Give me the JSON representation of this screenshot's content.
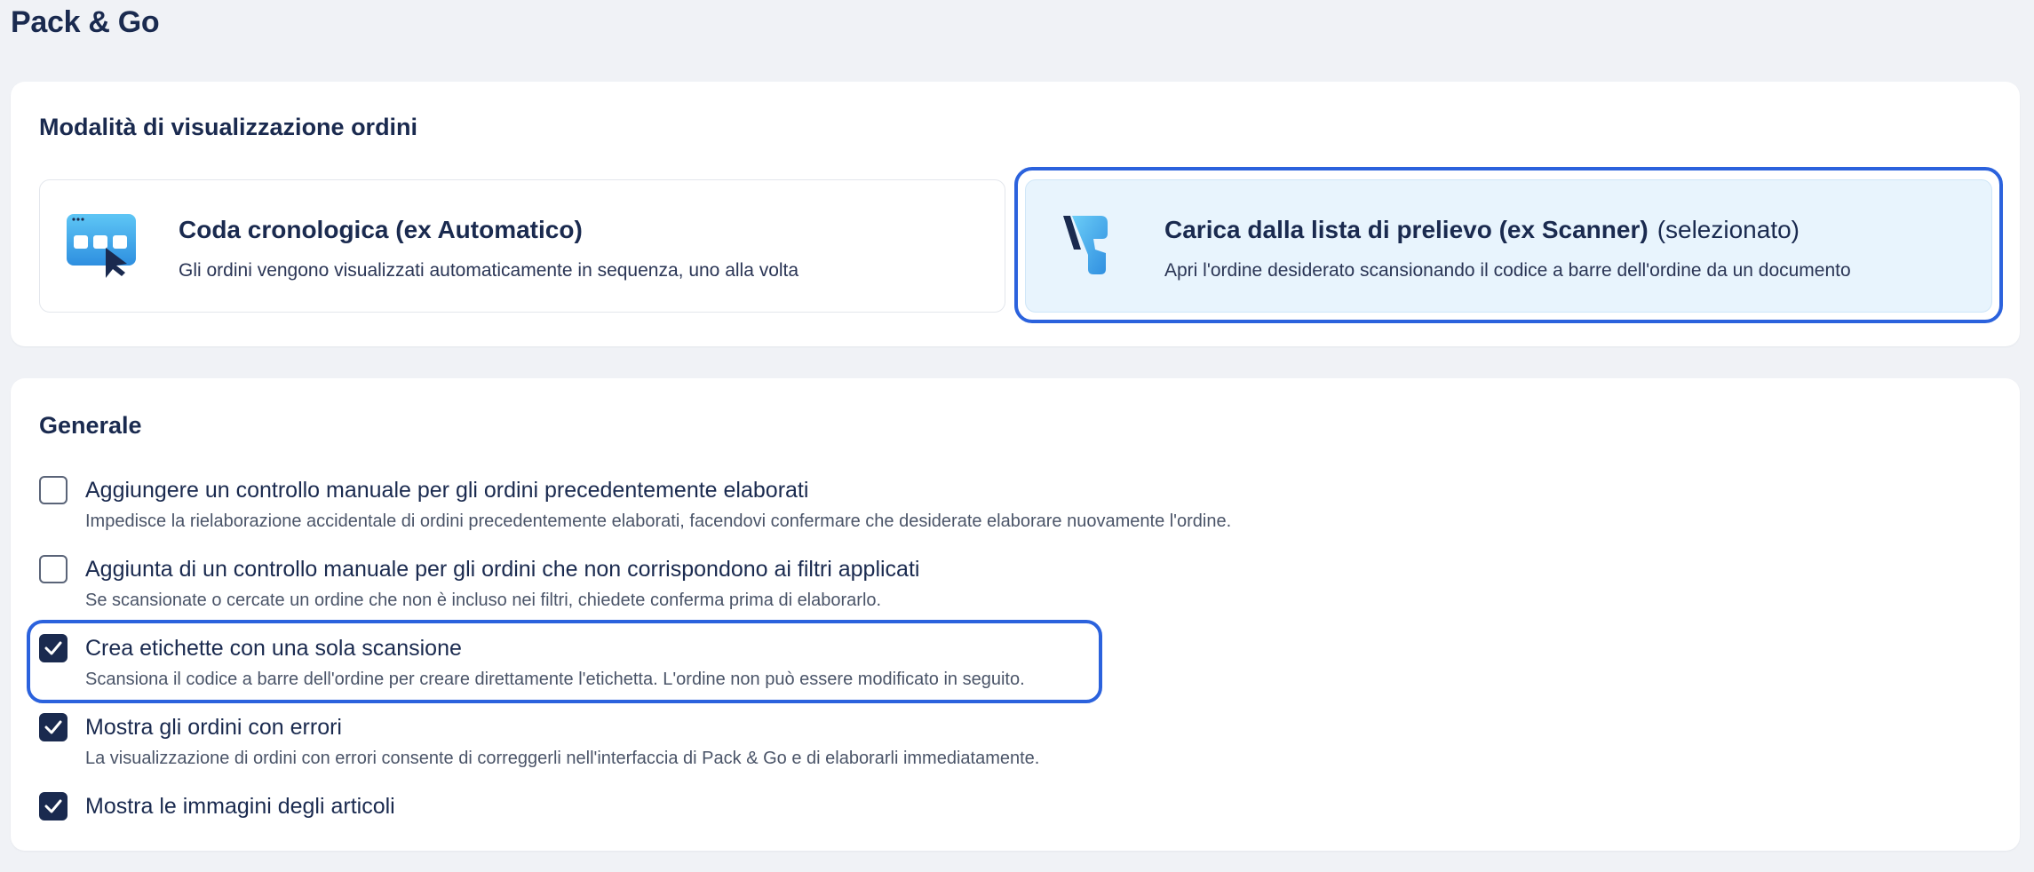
{
  "page": {
    "title": "Pack & Go"
  },
  "display_mode": {
    "heading": "Modalità di visualizzazione ordini",
    "options": [
      {
        "title": "Coda cronologica (ex Automatico)",
        "tag": "",
        "description": "Gli ordini vengono visualizzati automaticamente in sequenza, uno alla volta",
        "icon": "queue-cursor-icon",
        "selected": false
      },
      {
        "title": "Carica dalla lista di prelievo (ex Scanner)",
        "tag": "(selezionato)",
        "description": "Apri l'ordine desiderato scansionando il codice a barre dell'ordine da un documento",
        "icon": "barcode-scanner-icon",
        "selected": true
      }
    ]
  },
  "general": {
    "heading": "Generale",
    "options": [
      {
        "label": "Aggiungere un controllo manuale per gli ordini precedentemente elaborati",
        "description": "Impedisce la rielaborazione accidentale di ordini precedentemente elaborati, facendovi confermare che desiderate elaborare nuovamente l'ordine.",
        "checked": false
      },
      {
        "label": "Aggiunta di un controllo manuale per gli ordini che non corrispondono ai filtri applicati",
        "description": "Se scansionate o cercate un ordine che non è incluso nei filtri, chiedete conferma prima di elaborarlo.",
        "checked": false
      },
      {
        "label": "Crea etichette con una sola scansione",
        "description": "Scansiona il codice a barre dell'ordine per creare direttamente l'etichetta. L'ordine non può essere modificato in seguito.",
        "checked": true
      },
      {
        "label": "Mostra gli ordini con errori",
        "description": "La visualizzazione di ordini con errori consente di correggerli nell'interfaccia di Pack & Go e di elaborarli immediatamente.",
        "checked": true
      },
      {
        "label": "Mostra le immagini degli articoli",
        "description": "",
        "checked": true
      }
    ]
  },
  "colors": {
    "accent_ring": "#2b62dd",
    "selected_bg": "#e8f4fd",
    "checkbox_checked": "#1a2a4f",
    "title_text": "#1a2a4f"
  }
}
